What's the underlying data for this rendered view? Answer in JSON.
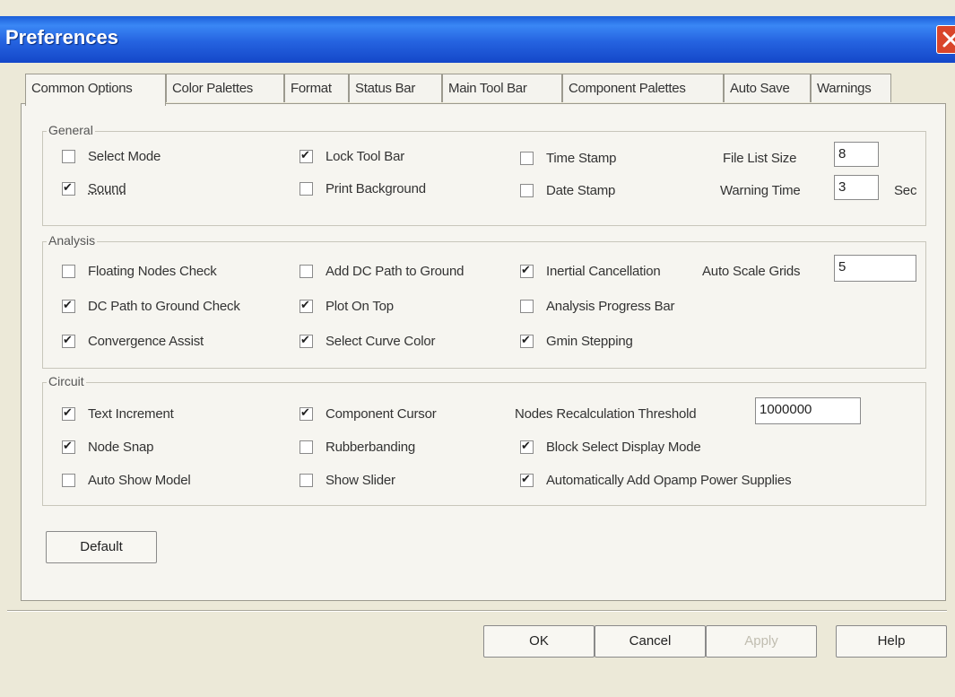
{
  "window": {
    "title": "Preferences"
  },
  "tabs": [
    {
      "label": "Common Options"
    },
    {
      "label": "Color Palettes"
    },
    {
      "label": "Format"
    },
    {
      "label": "Status Bar"
    },
    {
      "label": "Main Tool Bar"
    },
    {
      "label": "Component Palettes"
    },
    {
      "label": "Auto Save"
    },
    {
      "label": "Warnings"
    }
  ],
  "general": {
    "label": "General",
    "select_mode": {
      "label": "Select Mode",
      "checked": false
    },
    "sound": {
      "label": "Sound",
      "checked": true
    },
    "lock_tool_bar": {
      "label": "Lock Tool Bar",
      "checked": true
    },
    "print_background": {
      "label": "Print Background",
      "checked": false
    },
    "time_stamp": {
      "label": "Time Stamp",
      "checked": false
    },
    "date_stamp": {
      "label": "Date Stamp",
      "checked": false
    },
    "file_list_size_label": "File List Size",
    "file_list_size_value": "8",
    "warning_time_label": "Warning Time",
    "warning_time_value": "3",
    "warning_time_unit": "Sec"
  },
  "analysis": {
    "label": "Analysis",
    "floating_nodes_check": {
      "label": "Floating Nodes Check",
      "checked": false
    },
    "dc_path_check": {
      "label": "DC Path to Ground Check",
      "checked": true
    },
    "convergence_assist": {
      "label": "Convergence Assist",
      "checked": true
    },
    "add_dc_path": {
      "label": "Add DC Path to Ground",
      "checked": false
    },
    "plot_on_top": {
      "label": "Plot On Top",
      "checked": true
    },
    "select_curve_color": {
      "label": "Select Curve Color",
      "checked": true
    },
    "inertial_cancellation": {
      "label": "Inertial Cancellation",
      "checked": true
    },
    "analysis_progress_bar": {
      "label": "Analysis Progress Bar",
      "checked": false
    },
    "gmin_stepping": {
      "label": "Gmin Stepping",
      "checked": true
    },
    "auto_scale_grids_label": "Auto Scale Grids",
    "auto_scale_grids_value": "5"
  },
  "circuit": {
    "label": "Circuit",
    "text_increment": {
      "label": "Text Increment",
      "checked": true
    },
    "node_snap": {
      "label": "Node Snap",
      "checked": true
    },
    "auto_show_model": {
      "label": "Auto Show Model",
      "checked": false
    },
    "component_cursor": {
      "label": "Component Cursor",
      "checked": true
    },
    "rubberbanding": {
      "label": "Rubberbanding",
      "checked": false
    },
    "show_slider": {
      "label": "Show Slider",
      "checked": false
    },
    "nodes_recalc_label": "Nodes Recalculation Threshold",
    "nodes_recalc_value": "1000000",
    "block_select_display_mode": {
      "label": "Block Select Display Mode",
      "checked": true
    },
    "auto_add_opamp": {
      "label": "Automatically Add Opamp Power Supplies",
      "checked": true
    }
  },
  "buttons": {
    "default": "Default",
    "ok": "OK",
    "cancel": "Cancel",
    "apply": "Apply",
    "help": "Help"
  },
  "colors": {
    "titlebar": "#2563e0",
    "dialog_bg": "#ece9d8",
    "panel_bg": "#f6f5f0"
  }
}
